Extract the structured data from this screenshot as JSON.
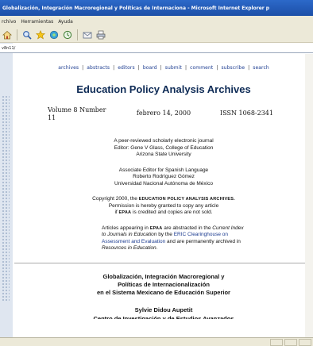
{
  "window": {
    "title": "Globalización, Integración Macroregional y Políticas de Internaciona - Microsoft Internet Explorer p"
  },
  "menu": [
    "rchivo",
    "Herramientas",
    "Ayuda"
  ],
  "toolbar_icons": [
    "home-icon",
    "search-icon",
    "favorites-icon",
    "media-icon",
    "history-icon",
    "mail-icon",
    "print-icon"
  ],
  "address": {
    "value": "v8n11/"
  },
  "nav": {
    "links": [
      "archives",
      "abstracts",
      "editors",
      "board",
      "submit",
      "comment",
      "subscribe",
      "search"
    ]
  },
  "journal": {
    "title": "Education Policy Analysis Archives",
    "volume": "Volume 8 Number 11",
    "date": "febrero 14, 2000",
    "issn": "ISSN 1068-2341"
  },
  "info": {
    "line1": "A peer-reviewed scholarly electronic journal",
    "line2": "Editor: Gene V Glass, College of Education",
    "line3": "Arizona State University",
    "assoc1": "Associate Editor for Spanish Language",
    "assoc2": "Roberto Rodríguez Gómez",
    "assoc3": "Universidad Nacional Autónoma de México",
    "copy_pre": "Copyright 2000, the ",
    "copy_sc": "EDUCATION POLICY ANALYSIS ARCHIVES.",
    "copy2": "Permission is hereby granted to copy any article",
    "copy3_pre": "if ",
    "copy3_sc": "EPAA",
    "copy3_post": " is credited and copies are not sold.",
    "abs_pre": "Articles appearing in ",
    "abs_sc": "EPAA",
    "abs_mid": " are abstracted in the ",
    "abs_cij": "Current Index to Journals in Education",
    "abs_by": " by the ",
    "abs_link": "ERIC Clearinghouse on Assessment and Evaluation",
    "abs_and": " and are permanently archived in ",
    "abs_rie": "Resources in Education",
    "abs_end": "."
  },
  "article": {
    "title1": "Globalización, Integración Macroregional y",
    "title2": "Políticas de Internacionalización",
    "title3": "en el Sistema Mexicano de Educación Superior",
    "author": "Sylvie Didou Aupetit",
    "affil": "Centro de Investigación y de Estudios Avanzados"
  }
}
